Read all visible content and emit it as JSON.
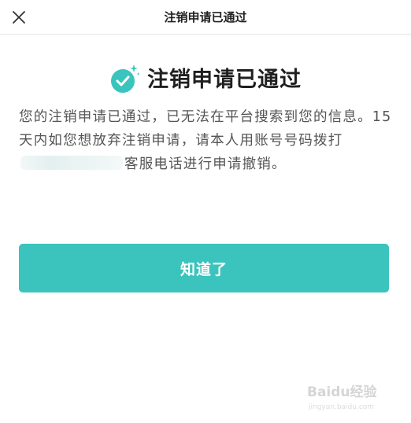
{
  "nav": {
    "title": "注销申请已通过"
  },
  "icons": {
    "close": "close-icon",
    "success": "check-circle-icon"
  },
  "heading": {
    "text": "注销申请已通过"
  },
  "description": {
    "part1": "您的注销申请已通过，已无法在平台搜索到您的信息。15 天内如您想放弃注销申请，请本人用账号号码拨打",
    "part2": "客服电话进行申请撤销。"
  },
  "button": {
    "label": "知道了"
  },
  "watermark": {
    "text": "Baidu经验",
    "url_text": "jingyan.baidu.com"
  },
  "colors": {
    "accent": "#3ac4bd",
    "text_primary": "#1f1f1f",
    "text_secondary": "#555555"
  }
}
